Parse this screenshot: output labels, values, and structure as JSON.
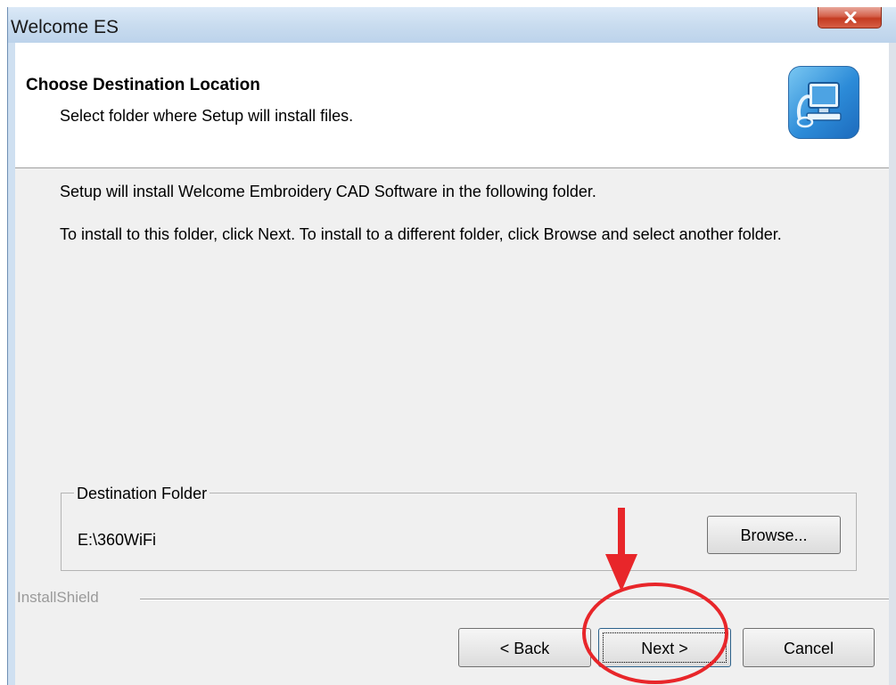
{
  "window": {
    "title": "Welcome ES"
  },
  "header": {
    "title": "Choose Destination Location",
    "subtitle": "Select folder where Setup will install files."
  },
  "body": {
    "message1": "Setup will install Welcome Embroidery CAD Software in the following folder.",
    "message2": "To install to this folder, click Next. To install to a different folder, click Browse and select another folder."
  },
  "destination": {
    "group_label": "Destination Folder",
    "path": "E:\\360WiFi",
    "browse_label": "Browse..."
  },
  "footer": {
    "brand": "InstallShield",
    "back_label": "< Back",
    "next_label": "Next >",
    "cancel_label": "Cancel"
  },
  "icons": {
    "close": "close-icon",
    "header_icon": "computer-setup-icon",
    "annotation_arrow": "red-arrow-icon",
    "annotation_circle": "red-circle-annotation"
  },
  "colors": {
    "close_button": "#c43b21",
    "annotation": "#e8262a",
    "titlebar": "#c9dcef"
  }
}
